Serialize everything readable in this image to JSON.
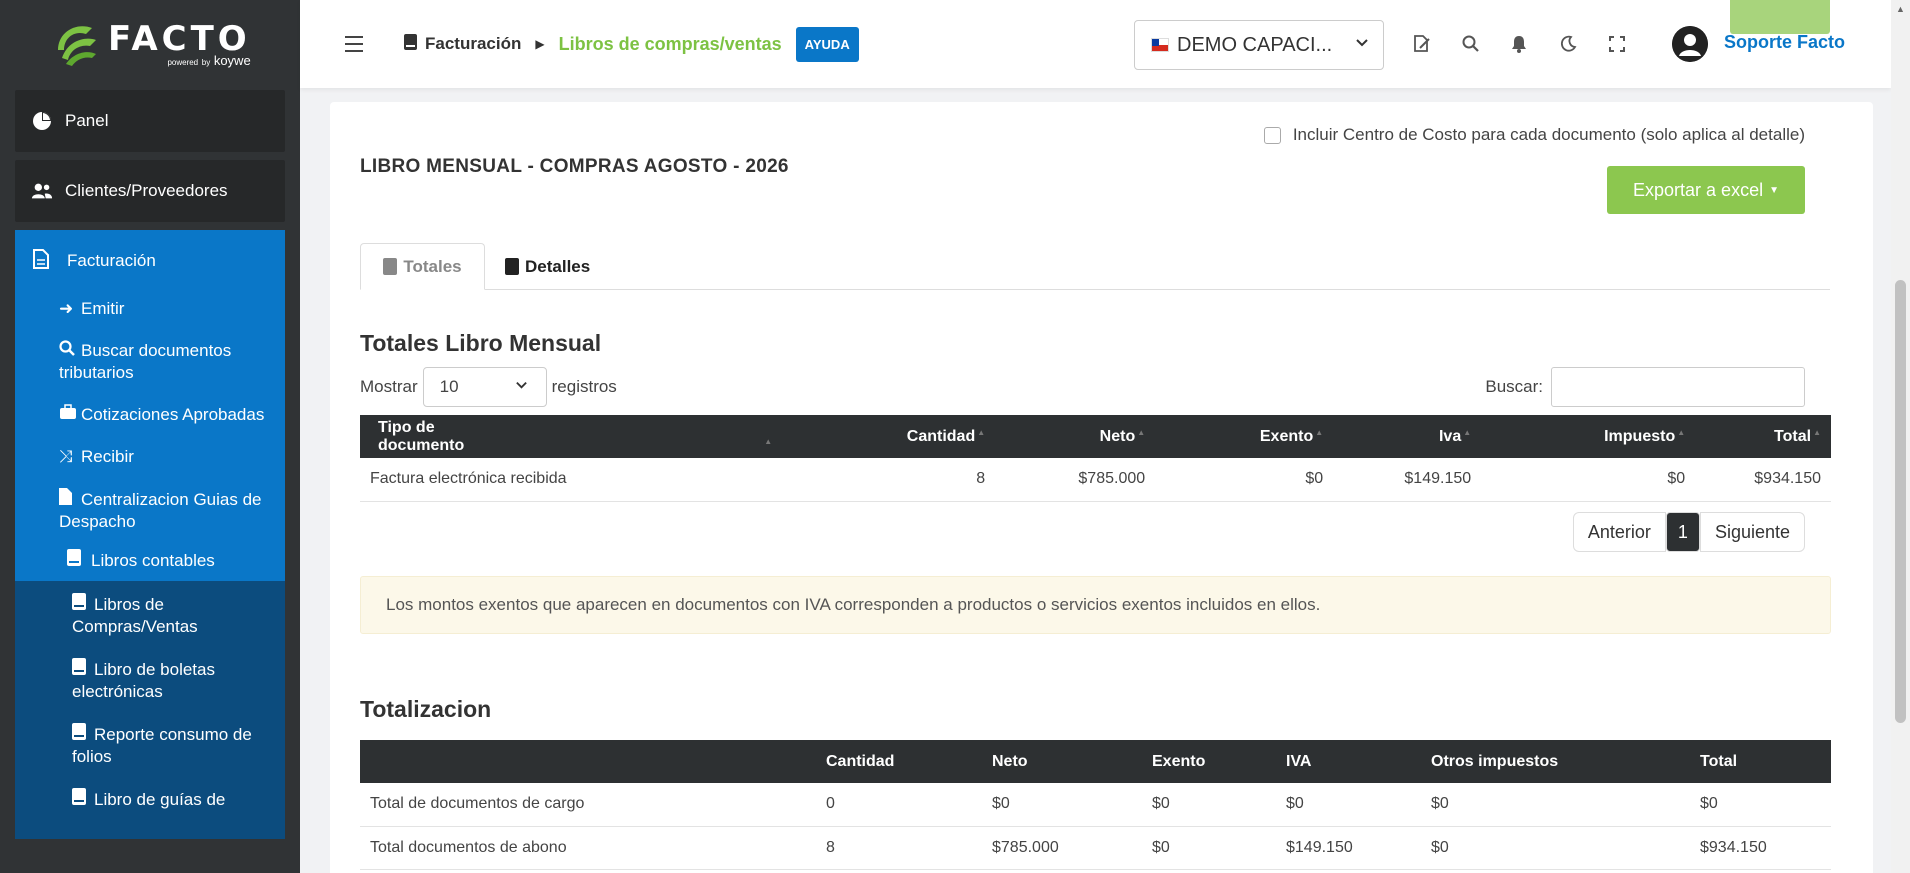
{
  "brand": {
    "name": "FACTO",
    "powered": "powered",
    "by": "by",
    "partner": "koywe",
    "accent": "#7dc243",
    "primary": "#0a77c8"
  },
  "sidebar": {
    "panel": "Panel",
    "clients": "Clientes/Proveedores",
    "facturacion": "Facturación",
    "sub": [
      "Emitir",
      "Buscar documentos tributarios",
      "Cotizaciones Aprobadas",
      "Recibir",
      "Centralizacion Guias de Despacho"
    ],
    "libros": "Libros contables",
    "libros_items": [
      "Libros de Compras/Ventas",
      "Libro de boletas electrónicas",
      "Reporte consumo de folios",
      "Libro de guías de"
    ]
  },
  "topbar": {
    "crumb1": "Facturación",
    "crumb2": "Libros de compras/ventas",
    "help": "AYUDA",
    "company": "DEMO CAPACI...",
    "user": "Soporte Facto"
  },
  "main": {
    "checkbox_label": "Incluir Centro de Costo para cada documento (solo aplica al detalle)",
    "title": "LIBRO MENSUAL - COMPRAS AGOSTO - 2026",
    "export": "Exportar a excel",
    "tabs": [
      "Totales",
      "Detalles"
    ],
    "totales_title": "Totales Libro Mensual",
    "show": "Mostrar",
    "show_value": "10",
    "records": "registros",
    "search": "Buscar:",
    "table1": {
      "headers": [
        "Tipo de documento",
        "Cantidad",
        "Neto",
        "Exento",
        "Iva",
        "Impuesto",
        "Total"
      ],
      "row": [
        "Factura electrónica recibida",
        "8",
        "$785.000",
        "$0",
        "$149.150",
        "$0",
        "$934.150"
      ]
    },
    "pager": {
      "prev": "Anterior",
      "current": "1",
      "next": "Siguiente"
    },
    "note": "Los montos exentos que aparecen en documentos con IVA corresponden a productos o servicios exentos incluidos en ellos.",
    "totalizacion_title": "Totalizacion",
    "table2": {
      "headers": [
        "",
        "Cantidad",
        "Neto",
        "Exento",
        "IVA",
        "Otros impuestos",
        "Total"
      ],
      "rows": [
        [
          "Total de documentos de cargo",
          "0",
          "$0",
          "$0",
          "$0",
          "$0",
          "$0"
        ],
        [
          "Total documentos de abono",
          "8",
          "$785.000",
          "$0",
          "$149.150",
          "$0",
          "$934.150"
        ]
      ]
    }
  }
}
